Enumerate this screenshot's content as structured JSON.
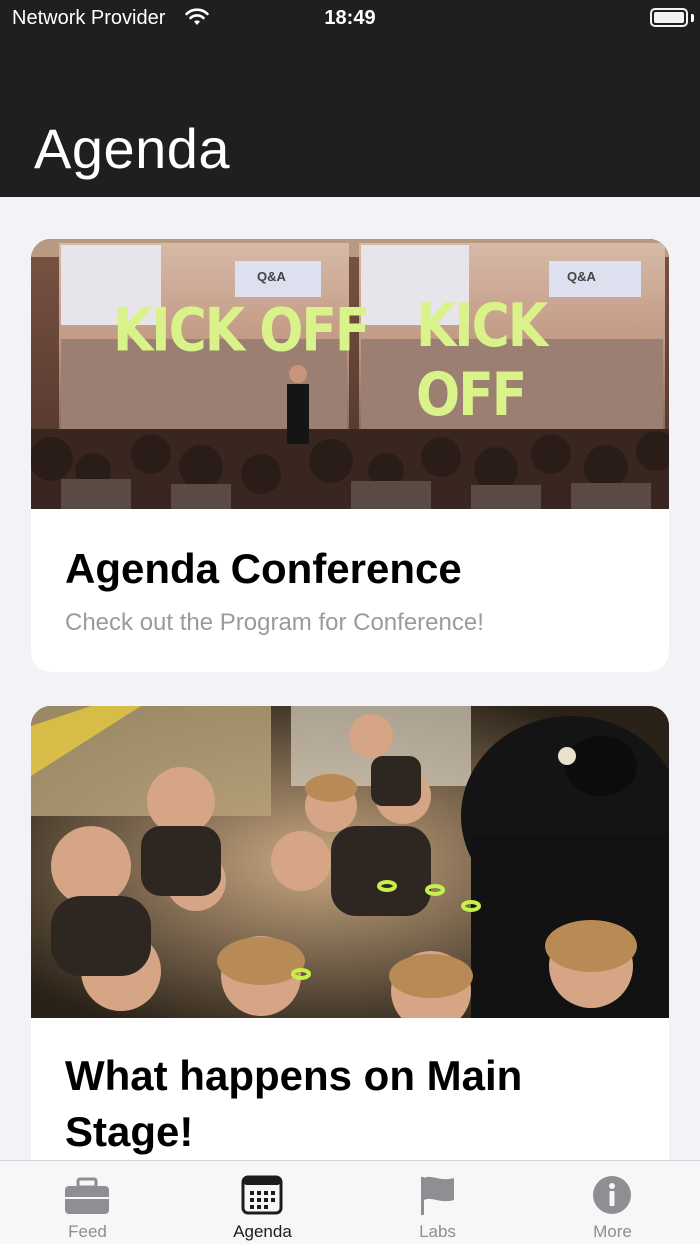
{
  "status_bar": {
    "carrier": "Network Provider",
    "time": "18:49"
  },
  "header": {
    "title": "Agenda"
  },
  "cards": [
    {
      "title": "Agenda Conference",
      "subtitle": "Check out the Program for Conference!",
      "image_text_left": "KICK OFF",
      "image_text_right": "KICK OFF",
      "slide_badge": "Q&A"
    },
    {
      "title": "What happens on Main Stage!"
    }
  ],
  "tab_bar": {
    "active": "Agenda",
    "tabs": [
      {
        "label": "Feed",
        "icon": "briefcase-icon"
      },
      {
        "label": "Agenda",
        "icon": "calendar-icon"
      },
      {
        "label": "Labs",
        "icon": "flag-icon"
      },
      {
        "label": "More",
        "icon": "info-icon"
      }
    ]
  },
  "colors": {
    "header_bg": "#1f1f1f",
    "page_bg": "#f2f2f7",
    "kickoff_text": "#d9f28a",
    "tab_inactive": "#8e8e93",
    "tab_active": "#1c1c1e"
  }
}
